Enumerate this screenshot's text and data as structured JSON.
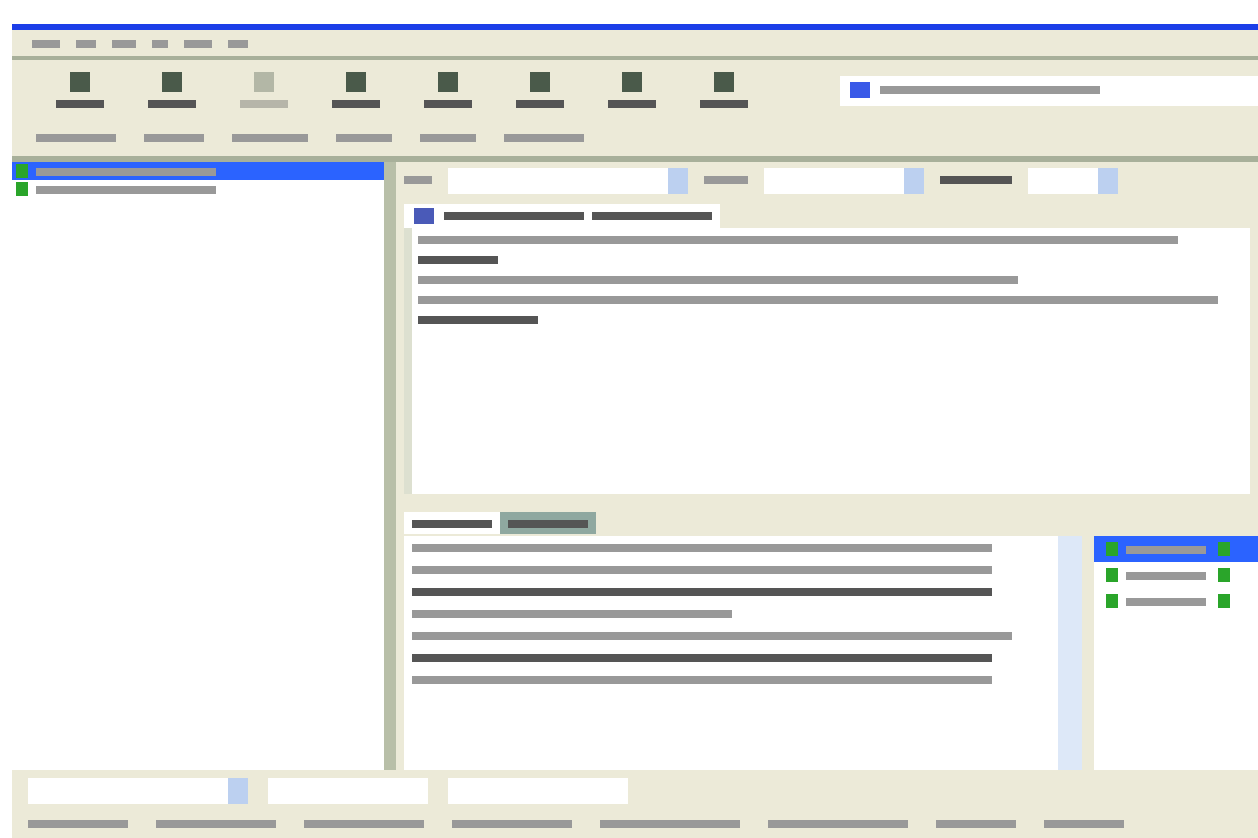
{
  "toolbar": {
    "buttons": [
      {
        "disabled": false
      },
      {
        "disabled": false
      },
      {
        "disabled": true
      },
      {
        "disabled": false
      },
      {
        "disabled": false
      },
      {
        "disabled": false
      },
      {
        "disabled": false
      },
      {
        "disabled": false
      }
    ]
  },
  "tree": {
    "items": [
      {
        "selected": true
      },
      {
        "selected": false
      }
    ]
  },
  "notes_tabs": [
    {
      "selected": true
    },
    {
      "selected": false
    }
  ],
  "side_list": {
    "items": [
      {
        "selected": true
      },
      {
        "selected": false
      },
      {
        "selected": false
      }
    ]
  }
}
